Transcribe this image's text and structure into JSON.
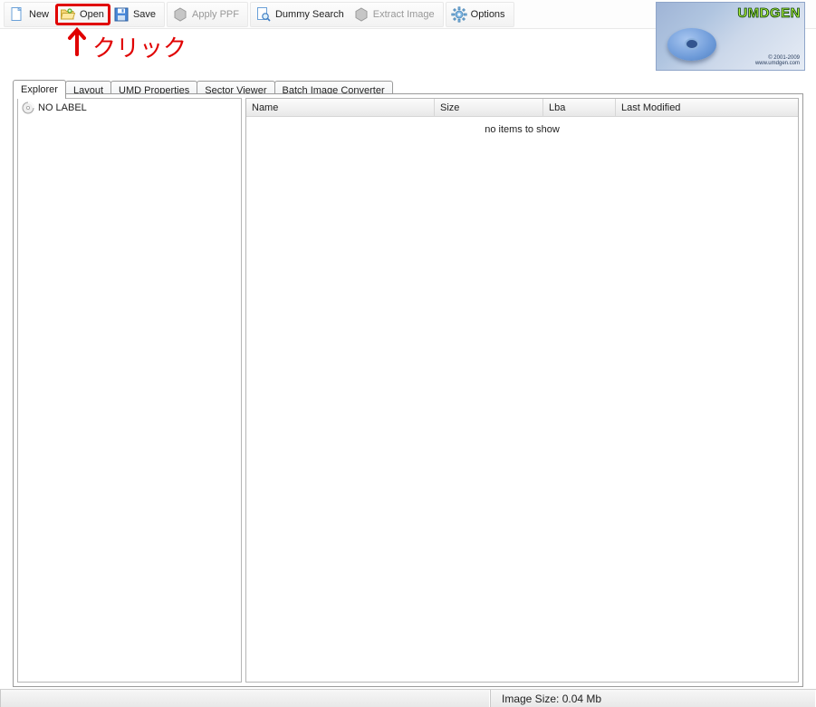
{
  "toolbar": {
    "new_label": "New",
    "open_label": "Open",
    "save_label": "Save",
    "apply_ppf_label": "Apply PPF",
    "dummy_search_label": "Dummy Search",
    "extract_image_label": "Extract Image",
    "options_label": "Options"
  },
  "logo": {
    "brand": "UMDGEN",
    "copyright_line1": "© 2001-2009",
    "copyright_line2": "www.umdgen.com"
  },
  "tabs": [
    {
      "label": "Explorer",
      "active": true
    },
    {
      "label": "Layout",
      "active": false
    },
    {
      "label": "UMD Properties",
      "active": false
    },
    {
      "label": "Sector Viewer",
      "active": false
    },
    {
      "label": "Batch Image Converter",
      "active": false
    }
  ],
  "tree": {
    "root_label": "NO LABEL"
  },
  "list": {
    "columns": {
      "name": "Name",
      "size": "Size",
      "lba": "Lba",
      "modified": "Last Modified"
    },
    "empty_message": "no items to show",
    "rows": []
  },
  "statusbar": {
    "image_size_label": "Image Size: 0.04 Mb"
  },
  "annotation": {
    "text": "クリック",
    "color": "#e00000",
    "target": "open-button"
  }
}
